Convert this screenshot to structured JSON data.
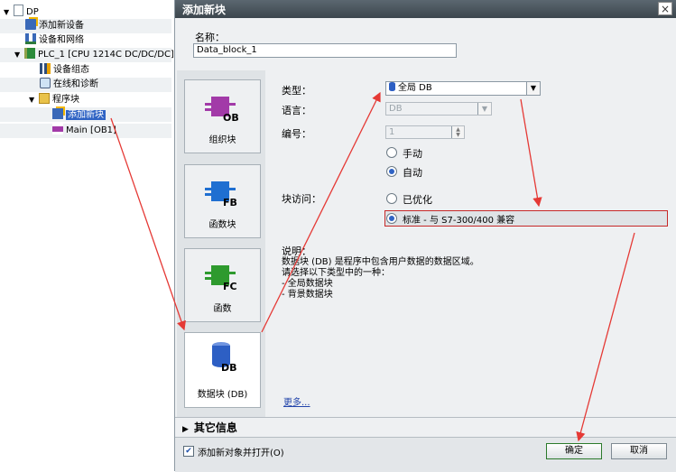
{
  "tree": {
    "items": [
      {
        "label": "DP",
        "icon": "project-icon"
      },
      {
        "label": "添加新设备",
        "icon": "add-device-icon"
      },
      {
        "label": "设备和网络",
        "icon": "network-icon"
      },
      {
        "label": "PLC_1 [CPU 1214C DC/DC/DC]",
        "icon": "plc-icon"
      },
      {
        "label": "设备组态",
        "icon": "device-config-icon"
      },
      {
        "label": "在线和诊断",
        "icon": "online-diagnostics-icon"
      },
      {
        "label": "程序块",
        "icon": "folder-icon"
      },
      {
        "label": "添加新块",
        "icon": "add-block-icon"
      },
      {
        "label": "Main [OB1]",
        "icon": "ob-block-icon"
      }
    ]
  },
  "dialog": {
    "title": "添加新块",
    "close": "×",
    "name_label": "名称：",
    "name_value": "Data_block_1",
    "block_types": [
      {
        "badge": "OB",
        "label": "组织块",
        "color": "#a23aa8"
      },
      {
        "badge": "FB",
        "label": "函数块",
        "color": "#1f6fd1"
      },
      {
        "badge": "FC",
        "label": "函数",
        "color": "#2e9a2e"
      },
      {
        "badge": "DB",
        "label": "数据块 (DB)",
        "color": "#2d5fc4"
      }
    ],
    "type_label": "类型：",
    "type_value": "全局 DB",
    "language_label": "语言：",
    "language_value": "DB",
    "number_label": "编号：",
    "number_value": "1",
    "manual": "手动",
    "auto": "自动",
    "access_label": "块访问：",
    "optimized": "已优化",
    "standard": "标准 - 与 S7-300/400 兼容",
    "desc_label": "说明：",
    "description": "数据块 (DB) 是程序中包含用户数据的数据区域。\n请选择以下类型中的一种：\n- 全局数据块\n- 背景数据块",
    "more_link": "更多...",
    "other_info": "其它信息",
    "open_after_add": "添加新对象并打开(O)",
    "ok": "确定",
    "cancel": "取消"
  },
  "colors": {
    "arrow": "#e53935",
    "selection": "#2f63c4",
    "titlebar": "#46525a"
  }
}
